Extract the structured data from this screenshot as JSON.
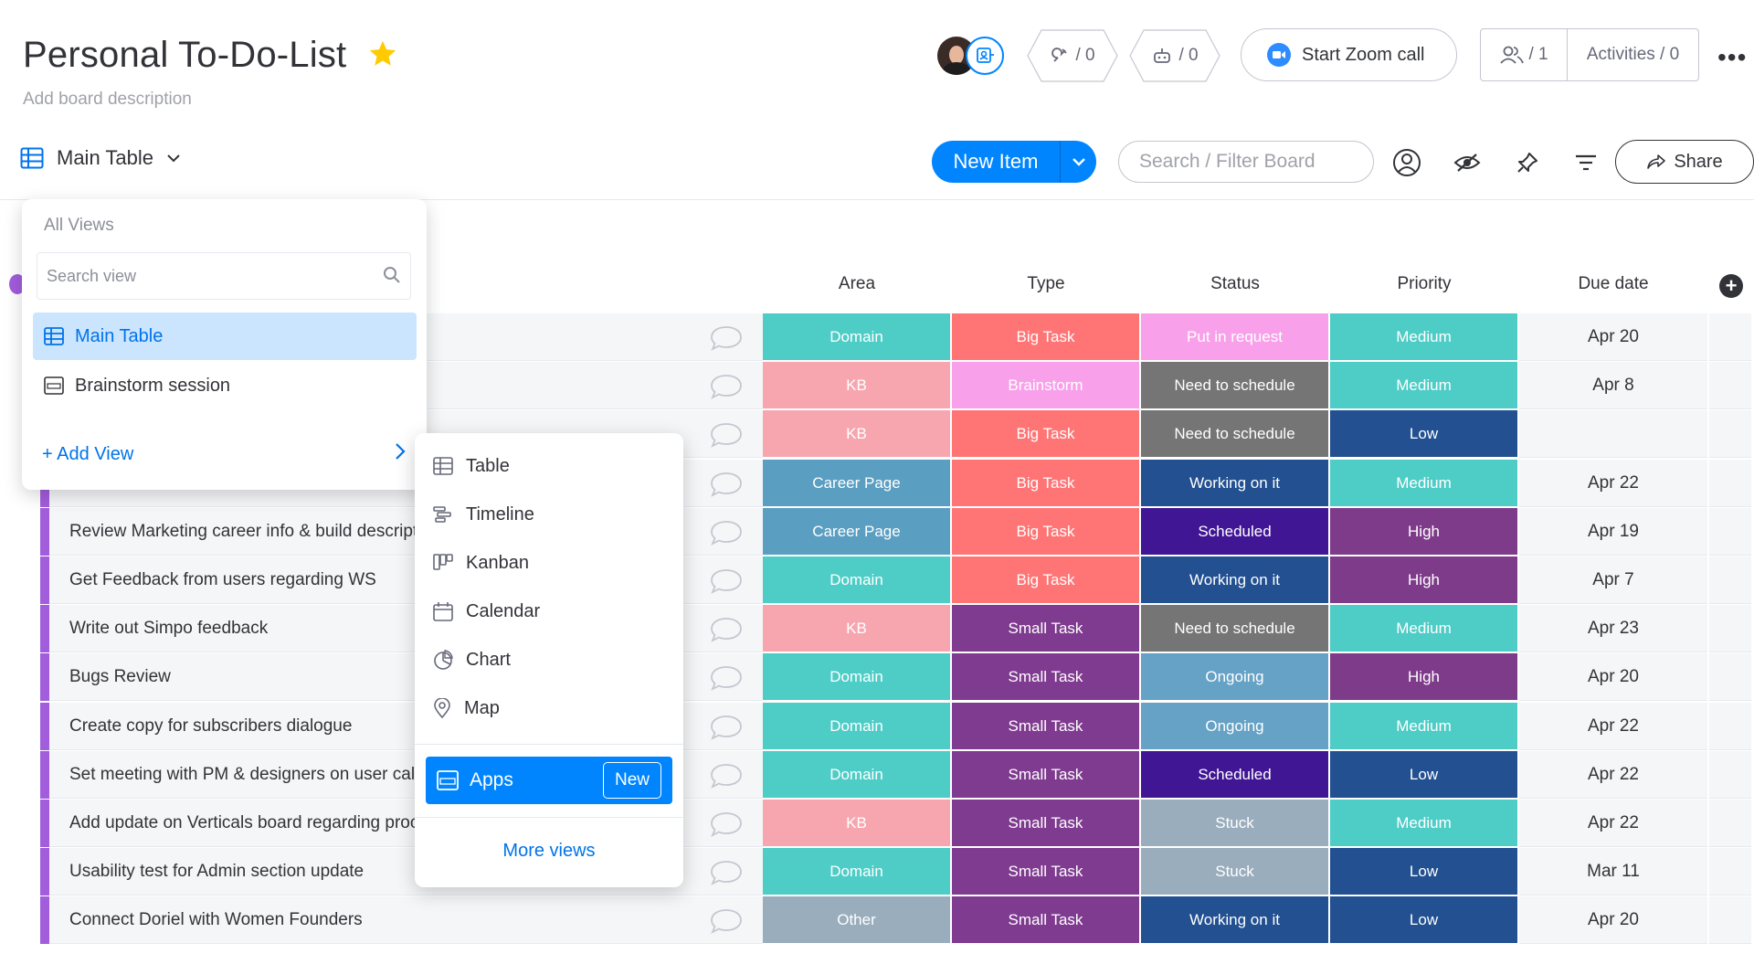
{
  "board": {
    "title": "Personal To-Do-List",
    "description": "Add board description"
  },
  "header": {
    "integrations_count": "/ 0",
    "automations_count": "/ 0",
    "zoom_label": "Start Zoom call",
    "people_count": "/ 1",
    "activities_label": "Activities / 0",
    "more_label": "•••"
  },
  "toolbar": {
    "view_label": "Main Table",
    "new_item_label": "New Item",
    "search_placeholder": "Search / Filter Board",
    "share_label": "Share"
  },
  "columns": [
    "Area",
    "Type",
    "Status",
    "Priority",
    "Due date"
  ],
  "colors": {
    "Domain": "#4eccc6",
    "KB": "#f7a6b0",
    "Career Page": "#5a9ec1",
    "Other": "#9aadbd",
    "Big Task": "#ff7575",
    "Brainstorm": "#f8a1ea",
    "Small Task": "#7f3b8f",
    "Put in request": "#f8a1ea",
    "Need to schedule": "#757575",
    "Working on it": "#225091",
    "Scheduled": "#401694",
    "Ongoing": "#66a1c6",
    "Stuck": "#9aadbd",
    "Medium": "#4eccc6",
    "Low": "#225091",
    "High": "#7e3b8a",
    "group": "#a25ddc",
    "accent": "#0085ff"
  },
  "rows": [
    {
      "name": "",
      "area": "Domain",
      "type": "Big Task",
      "status": "Put in request",
      "priority": "Medium",
      "due": "Apr 20"
    },
    {
      "name": "",
      "area": "KB",
      "type": "Brainstorm",
      "status": "Need to schedule",
      "priority": "Medium",
      "due": "Apr 8"
    },
    {
      "name": "",
      "area": "KB",
      "type": "Big Task",
      "status": "Need to schedule",
      "priority": "Low",
      "due": ""
    },
    {
      "name": "",
      "area": "Career Page",
      "type": "Big Task",
      "status": "Working on it",
      "priority": "Medium",
      "due": "Apr 22"
    },
    {
      "name": "Review Marketing career info & build description",
      "area": "Career Page",
      "type": "Big Task",
      "status": "Scheduled",
      "priority": "High",
      "due": "Apr 19"
    },
    {
      "name": "Get Feedback from users regarding WS",
      "area": "Domain",
      "type": "Big Task",
      "status": "Working on it",
      "priority": "High",
      "due": "Apr 7"
    },
    {
      "name": "Write out Simpo feedback",
      "area": "KB",
      "type": "Small Task",
      "status": "Need to schedule",
      "priority": "Medium",
      "due": "Apr 23"
    },
    {
      "name": "Bugs Review",
      "area": "Domain",
      "type": "Small Task",
      "status": "Ongoing",
      "priority": "High",
      "due": "Apr 20"
    },
    {
      "name": "Create copy for subscribers dialogue",
      "area": "Domain",
      "type": "Small Task",
      "status": "Ongoing",
      "priority": "Medium",
      "due": "Apr 22"
    },
    {
      "name": "Set meeting with PM & designers on user calls",
      "area": "Domain",
      "type": "Small Task",
      "status": "Scheduled",
      "priority": "Low",
      "due": "Apr 22"
    },
    {
      "name": "Add update on Verticals board regarding process",
      "area": "KB",
      "type": "Small Task",
      "status": "Stuck",
      "priority": "Medium",
      "due": "Apr 22"
    },
    {
      "name": "Usability test for Admin section update",
      "area": "Domain",
      "type": "Small Task",
      "status": "Stuck",
      "priority": "Low",
      "due": "Mar 11"
    },
    {
      "name": "Connect Doriel with Women Founders",
      "area": "Other",
      "type": "Small Task",
      "status": "Working on it",
      "priority": "Low",
      "due": "Apr 20"
    }
  ],
  "views_panel": {
    "header": "All Views",
    "search_placeholder": "Search view",
    "items": [
      "Main Table",
      "Brainstorm session"
    ],
    "add_view_label": "+ Add View"
  },
  "add_view_menu": {
    "items": [
      "Table",
      "Timeline",
      "Kanban",
      "Calendar",
      "Chart",
      "Map"
    ],
    "apps_label": "Apps",
    "apps_badge": "New",
    "more_views_label": "More views"
  }
}
